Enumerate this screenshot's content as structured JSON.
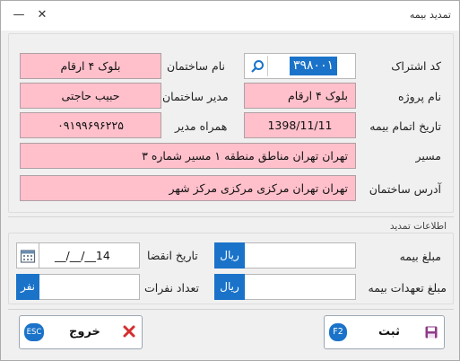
{
  "window": {
    "title": "تمدید بیمه",
    "close_glyph": "✕",
    "min_glyph": "—"
  },
  "form": {
    "subscription_code": {
      "label": "کد اشتراک",
      "value": "۳۹۸۰۰۱"
    },
    "building_name": {
      "label": "نام ساختمان",
      "value": "بلوک ۴ ارقام"
    },
    "project_name": {
      "label": "نام پروژه",
      "value": "بلوک ۴ ارقام"
    },
    "building_manager": {
      "label": "مدیر ساختمان",
      "value": "حبیب حاجتی"
    },
    "expiry_date": {
      "label": "تاریخ اتمام بیمه",
      "value": "1398/11/11"
    },
    "manager_mobile": {
      "label": "همراه مدیر",
      "value": "۰۹۱۹۹۶۹۶۲۲۵"
    },
    "route": {
      "label": "مسیر",
      "value": "تهران تهران مناطق منطقه ۱ مسیر شماره ۳"
    },
    "address": {
      "label": "آدرس ساختمان",
      "value": "تهران تهران مرکزی مرکزی مرکز شهر"
    }
  },
  "renewal": {
    "section_title": "اطلاعات تمدید",
    "insurance_amount": {
      "label": "مبلغ بیمه",
      "value": "",
      "unit": "ریال"
    },
    "obligations_amount": {
      "label": "مبلغ تعهدات بیمه",
      "value": "",
      "unit": "ریال"
    },
    "expiration_date": {
      "label": "تاریخ انقضا",
      "value": "__/__/__14"
    },
    "headcount": {
      "label": "تعداد نفرات",
      "value": "",
      "unit": "نفر"
    }
  },
  "actions": {
    "submit": {
      "label": "ثبت",
      "shortcut": "F2"
    },
    "exit": {
      "label": "خروج",
      "shortcut": "ESC"
    }
  },
  "colors": {
    "pink_field": "#ffc0cb",
    "accent_blue": "#1a73c9",
    "exit_red": "#d32f2f",
    "save_purple": "#8e3a8a"
  }
}
